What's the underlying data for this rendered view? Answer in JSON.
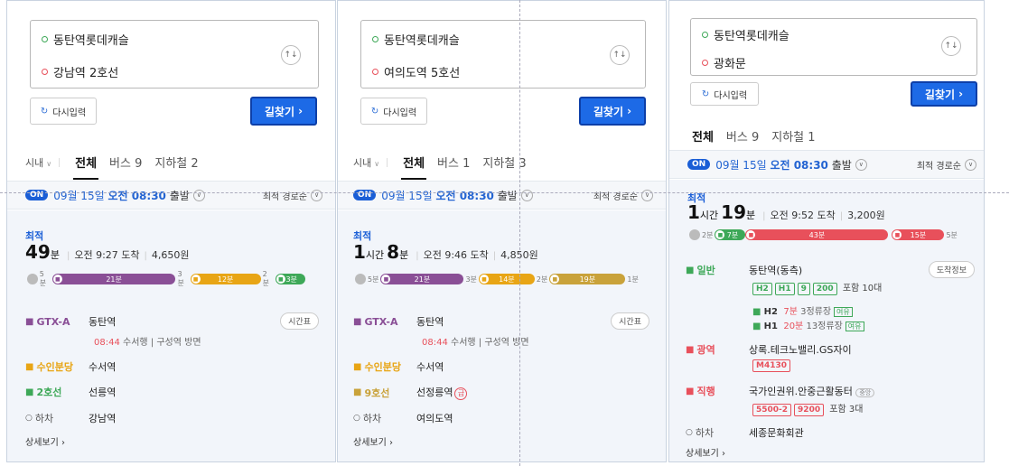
{
  "colors": {
    "accent": "#1d6ae6",
    "gtx": "#8a4f96",
    "suin": "#e8a515",
    "line2": "#3ea858",
    "line9": "#c9a23a",
    "red": "#e8505b",
    "green": "#3ea858"
  },
  "common": {
    "reset_label": "다시입력",
    "go_label": "길찾기",
    "sort_label": "최적 경로순",
    "on": "ON",
    "depart_date": "09월 15일",
    "depart_time": "오전 08:30",
    "depart_suffix": "출발",
    "best_label": "최적",
    "detail_label": "상세보기",
    "timetable_label": "시간표",
    "arrive_info_label": "도착정보",
    "getoff": "하차",
    "city": "시내"
  },
  "panels": [
    {
      "origin": "동탄역롯데캐슬",
      "dest": "강남역 2호선",
      "tabs": {
        "all": "전체",
        "bus": "버스 9",
        "subway": "지하철 2"
      },
      "summary": {
        "dur_h": "",
        "dur_m": "49",
        "arrive": "오전 9:27 도착",
        "fare": "4,650원"
      },
      "bar": {
        "walk1": "5분",
        "seg1": "21분",
        "walk2": "3분",
        "seg2": "12분",
        "walk3": "2분",
        "seg3": "3분"
      },
      "steps": [
        {
          "line": "GTX-A",
          "station": "동탄역",
          "sub_time": "08:44",
          "sub_text": "수서행 | 구성역 방면"
        },
        {
          "line": "수인분당",
          "station": "수서역"
        },
        {
          "line": "2호선",
          "station": "선릉역"
        },
        {
          "line": "하차",
          "station": "강남역"
        }
      ]
    },
    {
      "origin": "동탄역롯데캐슬",
      "dest": "여의도역 5호선",
      "tabs": {
        "all": "전체",
        "bus": "버스 1",
        "subway": "지하철 3"
      },
      "summary": {
        "dur_h": "1",
        "dur_m": "8",
        "arrive": "오전 9:46 도착",
        "fare": "4,850원"
      },
      "bar": {
        "walk1": "5분",
        "seg1": "21분",
        "walk2": "3분",
        "seg2": "14분",
        "walk3": "2분",
        "seg3": "19분",
        "walk4": "1분"
      },
      "steps": [
        {
          "line": "GTX-A",
          "station": "동탄역",
          "sub_time": "08:44",
          "sub_text": "수서행 | 구성역 방면"
        },
        {
          "line": "수인분당",
          "station": "수서역"
        },
        {
          "line": "9호선",
          "station": "선정릉역",
          "badge": "급"
        },
        {
          "line": "하차",
          "station": "여의도역"
        }
      ]
    },
    {
      "origin": "동탄역롯데캐슬",
      "dest": "광화문",
      "tabs": {
        "all": "전체",
        "bus": "버스 9",
        "subway": "지하철 1"
      },
      "summary": {
        "dur_h": "1",
        "dur_m": "19",
        "arrive": "오전 9:52 도착",
        "fare": "3,200원"
      },
      "bar": {
        "walk1": "2분",
        "seg1": "7분",
        "seg2": "43분",
        "seg3": "15분",
        "walk4": "5분"
      },
      "steps": [
        {
          "line": "일반",
          "station": "동탄역(동측)",
          "chips": [
            "H2",
            "H1",
            "9",
            "200"
          ],
          "extra": "포함 10대",
          "sub1_bus": "H2",
          "sub1_time": "7분",
          "sub1_info": "3정류장",
          "sub1_tag": "여유",
          "sub2_bus": "H1",
          "sub2_time": "20분",
          "sub2_info": "13정류장",
          "sub2_tag": "여유"
        },
        {
          "line": "광역",
          "station": "상록.테크노밸리.GS자이",
          "chips": [
            "M4130"
          ]
        },
        {
          "line": "직행",
          "station": "국가인권위.안중근활동터",
          "station_tag": "중앙",
          "chips": [
            "5500-2",
            "9200"
          ],
          "extra": "포함 3대"
        },
        {
          "line": "하차",
          "station": "세종문화회관"
        }
      ]
    }
  ]
}
